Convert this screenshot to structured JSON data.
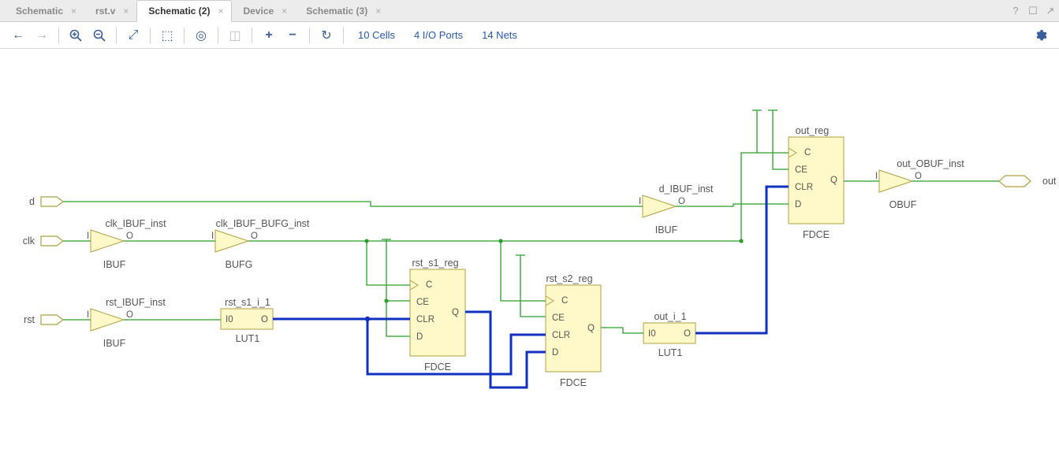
{
  "tabs": [
    {
      "label": "Schematic",
      "active": false
    },
    {
      "label": "rst.v",
      "active": false
    },
    {
      "label": "Schematic (2)",
      "active": true
    },
    {
      "label": "Device",
      "active": false
    },
    {
      "label": "Schematic (3)",
      "active": false
    }
  ],
  "toolbar_stats": {
    "cells": "10 Cells",
    "ports": "4 I/O Ports",
    "nets": "14 Nets"
  },
  "ports": {
    "d": {
      "label": "d",
      "dir": "in"
    },
    "clk": {
      "label": "clk",
      "dir": "in"
    },
    "rst": {
      "label": "rst",
      "dir": "in"
    },
    "out": {
      "label": "out",
      "dir": "out"
    }
  },
  "cells": {
    "clk_ibuf": {
      "inst": "clk_IBUF_inst",
      "type": "IBUF",
      "pin_i": "I",
      "pin_o": "O"
    },
    "clk_bufg": {
      "inst": "clk_IBUF_BUFG_inst",
      "type": "BUFG",
      "pin_i": "I",
      "pin_o": "O"
    },
    "rst_ibuf": {
      "inst": "rst_IBUF_inst",
      "type": "IBUF",
      "pin_i": "I",
      "pin_o": "O"
    },
    "d_ibuf": {
      "inst": "d_IBUF_inst",
      "type": "IBUF",
      "pin_i": "I",
      "pin_o": "O"
    },
    "obuf": {
      "inst": "out_OBUF_inst",
      "type": "OBUF",
      "pin_i": "I",
      "pin_o": "O"
    },
    "lut_rst": {
      "inst": "rst_s1_i_1",
      "type": "LUT1",
      "pin_i": "I0",
      "pin_o": "O"
    },
    "lut_out": {
      "inst": "out_i_1",
      "type": "LUT1",
      "pin_i": "I0",
      "pin_o": "O"
    },
    "ff_s1": {
      "inst": "rst_s1_reg",
      "type": "FDCE"
    },
    "ff_s2": {
      "inst": "rst_s2_reg",
      "type": "FDCE"
    },
    "ff_out": {
      "inst": "out_reg",
      "type": "FDCE"
    }
  },
  "ff_pins": {
    "c": "C",
    "ce": "CE",
    "clr": "CLR",
    "d": "D",
    "q": "Q"
  }
}
